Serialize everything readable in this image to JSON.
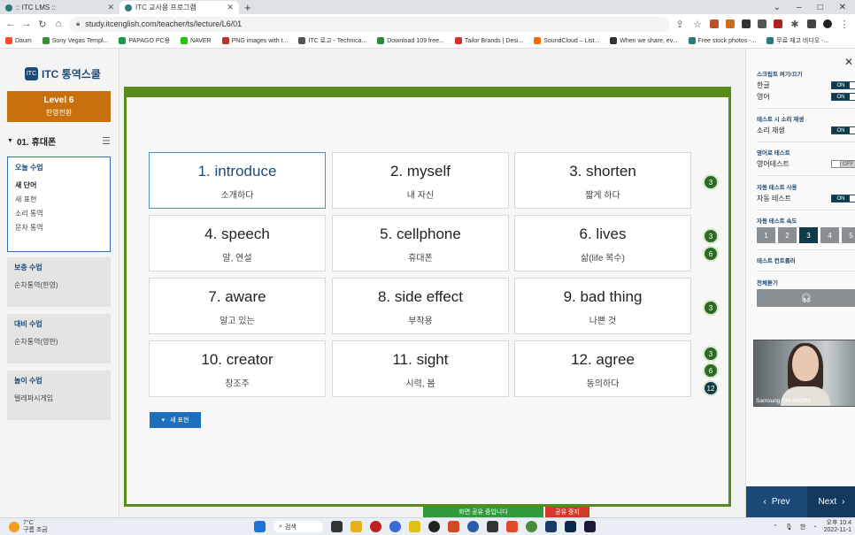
{
  "browser": {
    "tabs": [
      {
        "label": ":: ITC LMS ::",
        "active": false
      },
      {
        "label": "ITC 교사용 프로그램",
        "active": true
      }
    ],
    "new_tab": "+",
    "url": "study.itcenglish.com/teacher/ts/lecture/L6/01",
    "bookmarks": [
      {
        "label": "Daum",
        "color": "#ff4a2a"
      },
      {
        "label": "Sony Vegas Templ...",
        "color": "#3a8a3a"
      },
      {
        "label": "PAPAGO PC용",
        "color": "#1c9a4a"
      },
      {
        "label": "NAVER",
        "color": "#1ec800"
      },
      {
        "label": "PNG images with t...",
        "color": "#c03030"
      },
      {
        "label": "ITC 로고 - Technica...",
        "color": "#555555"
      },
      {
        "label": "Download 109 free...",
        "color": "#2a8a3a"
      },
      {
        "label": "Tailor Brands | Desi...",
        "color": "#d03030"
      },
      {
        "label": "SoundCloud – List...",
        "color": "#ff6a00"
      },
      {
        "label": "When we share, ev...",
        "color": "#333333"
      },
      {
        "label": "Free stock photos -...",
        "color": "#2a7a7a"
      },
      {
        "label": "무료 재고 비디오 -...",
        "color": "#2a7a7a"
      }
    ]
  },
  "sidebar": {
    "logo": "ITC 통역스쿨",
    "level_title": "Level 6",
    "level_subtitle": "한영전환",
    "chapter": "01. 휴대폰",
    "groups": [
      {
        "title": "오늘 수업",
        "items": [
          "새 단어",
          "새 표현",
          "소리 통역",
          "문자 통역"
        ]
      },
      {
        "title": "보충 수업",
        "items": [
          "순차통역(한영)"
        ]
      },
      {
        "title": "대비 수업",
        "items": [
          "순차통역(영한)"
        ]
      },
      {
        "title": "놀이 수업",
        "items": [
          "텔레파시게임"
        ]
      }
    ]
  },
  "cards": [
    {
      "word": "1. introduce",
      "meaning": "소개하다",
      "selected": true
    },
    {
      "word": "2. myself",
      "meaning": "내 자신",
      "selected": false
    },
    {
      "word": "3. shorten",
      "meaning": "짧게 하다",
      "selected": false
    },
    {
      "word": "4. speech",
      "meaning": "말, 연설",
      "selected": false
    },
    {
      "word": "5. cellphone",
      "meaning": "휴대폰",
      "selected": false
    },
    {
      "word": "6. lives",
      "meaning": "삶(life 복수)",
      "selected": false
    },
    {
      "word": "7. aware",
      "meaning": "알고 있는",
      "selected": false
    },
    {
      "word": "8. side effect",
      "meaning": "부작용",
      "selected": false
    },
    {
      "word": "9. bad thing",
      "meaning": "나쁜 것",
      "selected": false
    },
    {
      "word": "10. creator",
      "meaning": "창조주",
      "selected": false
    },
    {
      "word": "11. sight",
      "meaning": "시력, 봄",
      "selected": false
    },
    {
      "word": "12. agree",
      "meaning": "동의하다",
      "selected": false
    }
  ],
  "badges": [
    "3",
    "3",
    "6",
    "3",
    "3",
    "6",
    "12"
  ],
  "new_expression_button": "새 표현",
  "share_bar": {
    "status": "화면 공유 중입니다",
    "stop": "공유 중지"
  },
  "right_panel": {
    "script_title": "스크립트 켜기/끄기",
    "korean": "한글",
    "english": "영어",
    "on": "ON",
    "off": "OFF",
    "sound_title": "테스트 시 소리 재생",
    "sound_play": "소리 재생",
    "eng_test_title": "영어로 테스트",
    "eng_test": "영어테스트",
    "auto_title": "자동 테스트 사용",
    "auto_test": "자동 테스트",
    "speed_title": "자동 테스트 속도",
    "speeds": [
      "1",
      "2",
      "3",
      "4",
      "5"
    ],
    "speed_active": "3",
    "control_title": "테스트 컨트롤러",
    "listen_title": "전체듣기",
    "video_label": "Samsung SM-S908N",
    "prev": "Prev",
    "next": "Next"
  },
  "taskbar": {
    "temperature": "7°C",
    "weather": "구름 조금",
    "search": "검색",
    "lang": "한",
    "ampm": "오후 10:4",
    "date": "2022-11-1"
  }
}
